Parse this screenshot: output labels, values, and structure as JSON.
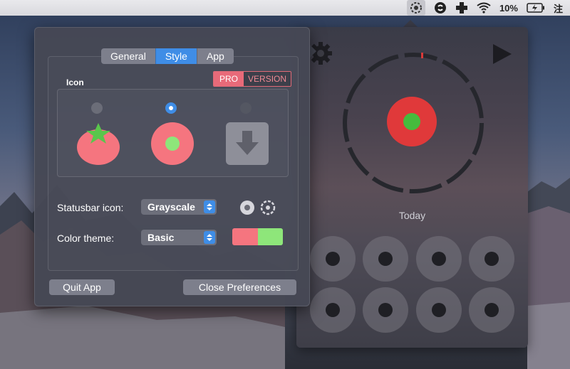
{
  "menubar": {
    "battery_percent": "10%",
    "input_method": "注"
  },
  "preferences": {
    "tabs": [
      "General",
      "Style",
      "App"
    ],
    "active_tab": "Style",
    "pro_badge": {
      "pro": "PRO",
      "version": "VERSION"
    },
    "icon_section_label": "Icon",
    "icon_options": [
      {
        "name": "tomato",
        "selected": false
      },
      {
        "name": "ring-dot",
        "selected": true
      },
      {
        "name": "download-box",
        "selected": false,
        "disabled": true
      }
    ],
    "statusbar_icon": {
      "label": "Statusbar icon:",
      "value": "Grayscale"
    },
    "color_theme": {
      "label": "Color theme:",
      "value": "Basic",
      "colors": [
        "#f5757f",
        "#8ee67a"
      ]
    },
    "quit_label": "Quit App",
    "close_label": "Close Preferences"
  },
  "timer": {
    "today_label": "Today",
    "ring_color": "#2a2b31",
    "center_outer_color": "#e0393a",
    "center_inner_color": "#46bb3d",
    "grid_count": 8
  },
  "icons": {
    "menubar": [
      "status-icon",
      "shazam-icon",
      "health-plus-icon",
      "wifi-icon",
      "battery-charging-icon"
    ],
    "timer": [
      "gear-icon",
      "play-icon"
    ]
  }
}
